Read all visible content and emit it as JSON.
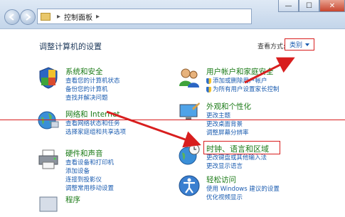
{
  "address": {
    "root_label": "控制面板"
  },
  "window_buttons": {
    "minimize": "—",
    "maximize": "☐",
    "close": "✕"
  },
  "header": {
    "title": "调整计算机的设置",
    "view_by_label": "查看方式:",
    "view_by_value": "类别"
  },
  "categories": [
    {
      "title": "系统和安全",
      "links": [
        "查看您的计算机状态",
        "备份您的计算机",
        "查找并解决问题"
      ],
      "icon": "shield-flag-icon"
    },
    {
      "title": "网络和 Internet",
      "links": [
        "查看网络状态和任务",
        "选择家庭组和共享选项"
      ],
      "icon": "network-globe-icon"
    },
    {
      "title": "硬件和声音",
      "links": [
        "查看设备和打印机",
        "添加设备",
        "连接到投影仪",
        "调整常用移动设置"
      ],
      "icon": "printer-icon"
    },
    {
      "title": "程序",
      "links": [],
      "icon": "programs-icon"
    },
    {
      "title": "用户帐户和家庭安全",
      "links": [
        "添加或删除用户帐户",
        "为所有用户设置家长控制"
      ],
      "icon": "users-icon"
    },
    {
      "title": "外观和个性化",
      "links": [
        "更改主题",
        "更改桌面背景",
        "调整屏幕分辨率"
      ],
      "icon": "monitor-brush-icon"
    },
    {
      "title": "时钟、语言和区域",
      "links": [
        "更改键盘或其他输入法",
        "更改显示语言"
      ],
      "icon": "clock-globe-icon"
    },
    {
      "title": "轻松访问",
      "links": [
        "使用 Windows 建议的设置",
        "优化视频显示"
      ],
      "icon": "ease-of-access-icon"
    }
  ],
  "colors": {
    "category_title": "#1a7a16",
    "link": "#1b5cb0",
    "annotation_red": "#d81e1e"
  }
}
